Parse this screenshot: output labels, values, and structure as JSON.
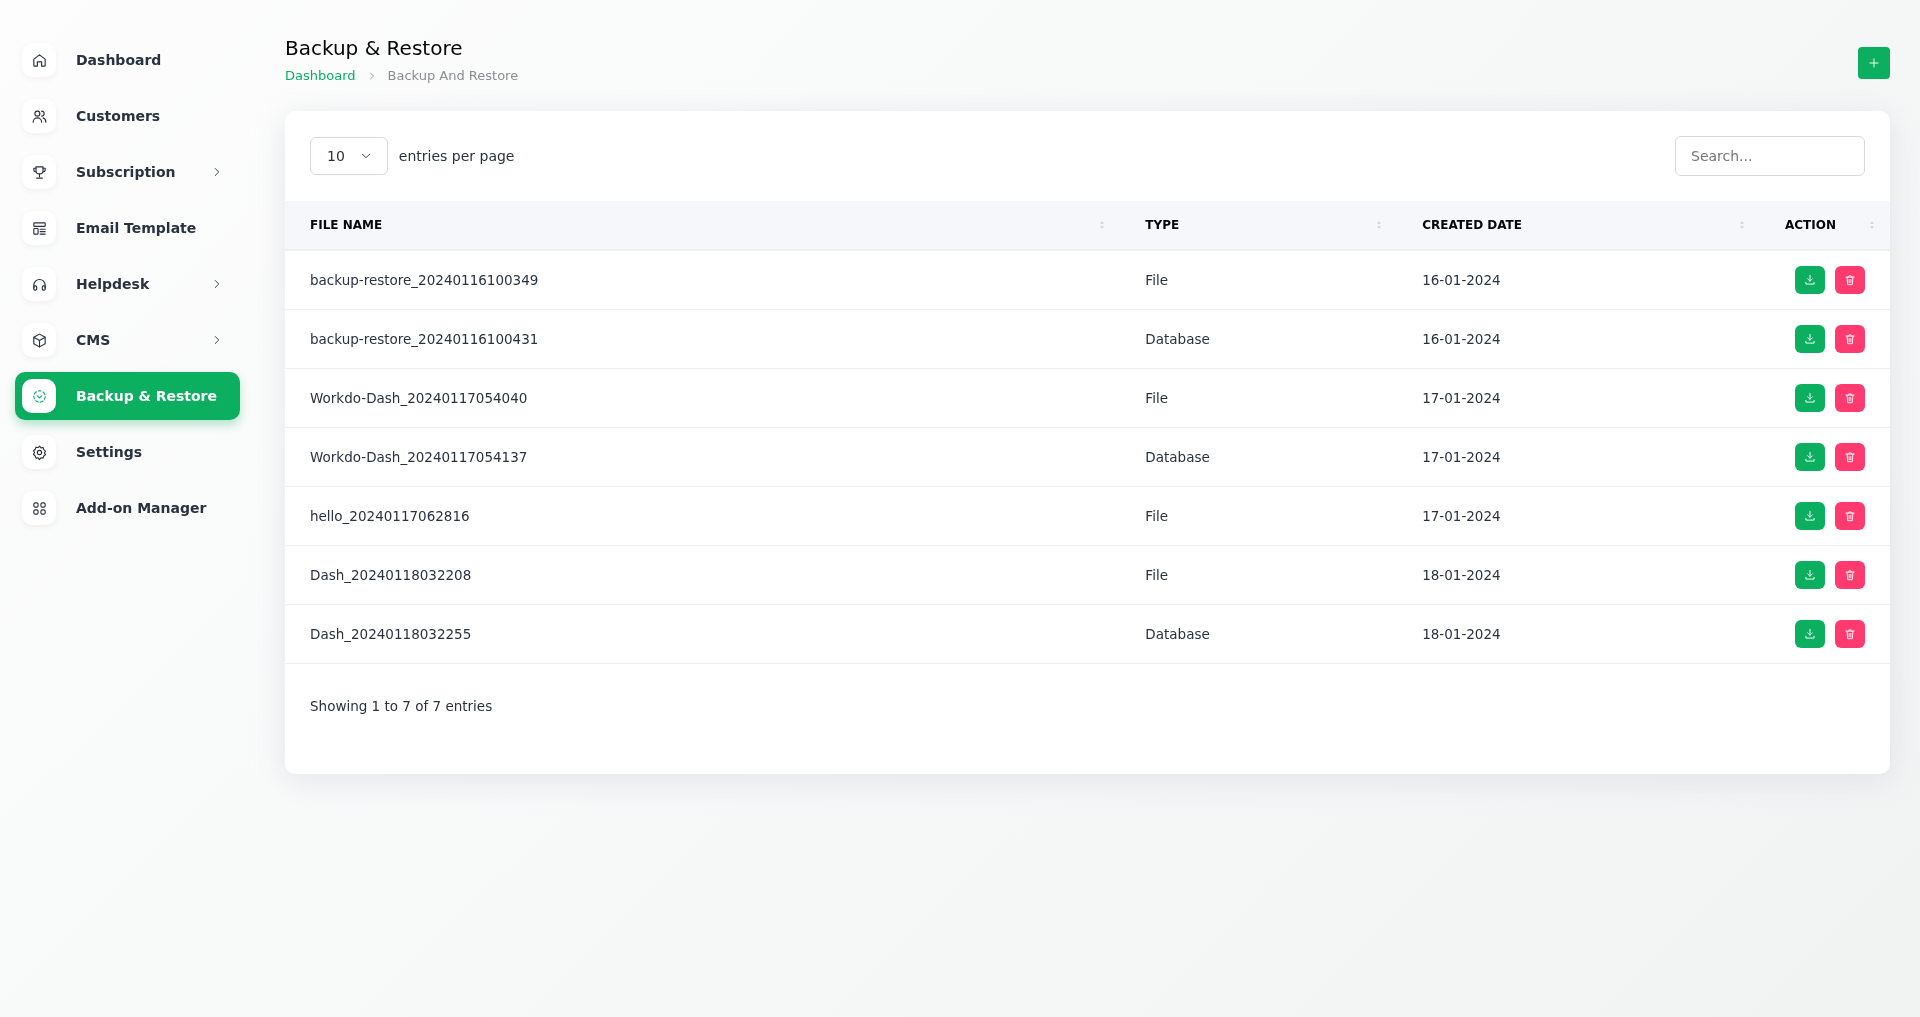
{
  "sidebar": {
    "items": [
      {
        "label": "Dashboard",
        "has_submenu": false,
        "selected": false
      },
      {
        "label": "Customers",
        "has_submenu": false,
        "selected": false
      },
      {
        "label": "Subscription",
        "has_submenu": true,
        "selected": false
      },
      {
        "label": "Email Template",
        "has_submenu": false,
        "selected": false
      },
      {
        "label": "Helpdesk",
        "has_submenu": true,
        "selected": false
      },
      {
        "label": "CMS",
        "has_submenu": true,
        "selected": false
      },
      {
        "label": "Backup & Restore",
        "has_submenu": false,
        "selected": true
      },
      {
        "label": "Settings",
        "has_submenu": false,
        "selected": false
      },
      {
        "label": "Add-on Manager",
        "has_submenu": false,
        "selected": false
      }
    ]
  },
  "page": {
    "title": "Backup & Restore",
    "breadcrumb": [
      "Dashboard",
      "Backup And Restore"
    ]
  },
  "table": {
    "page_size": "10",
    "page_size_label": "entries per page",
    "search": {
      "placeholder": "Search..."
    },
    "columns": [
      "FILE NAME",
      "TYPE",
      "CREATED DATE",
      "ACTION"
    ],
    "rows": [
      {
        "file_name": "backup-restore_20240116100349",
        "type": "File",
        "created_date": "16-01-2024"
      },
      {
        "file_name": "backup-restore_20240116100431",
        "type": "Database",
        "created_date": "16-01-2024"
      },
      {
        "file_name": "Workdo-Dash_20240117054040",
        "type": "File",
        "created_date": "17-01-2024"
      },
      {
        "file_name": "Workdo-Dash_20240117054137",
        "type": "Database",
        "created_date": "17-01-2024"
      },
      {
        "file_name": "hello_20240117062816",
        "type": "File",
        "created_date": "17-01-2024"
      },
      {
        "file_name": "Dash_20240118032208",
        "type": "File",
        "created_date": "18-01-2024"
      },
      {
        "file_name": "Dash_20240118032255",
        "type": "Database",
        "created_date": "18-01-2024"
      }
    ],
    "footer": "Showing 1 to 7 of 7 entries"
  }
}
